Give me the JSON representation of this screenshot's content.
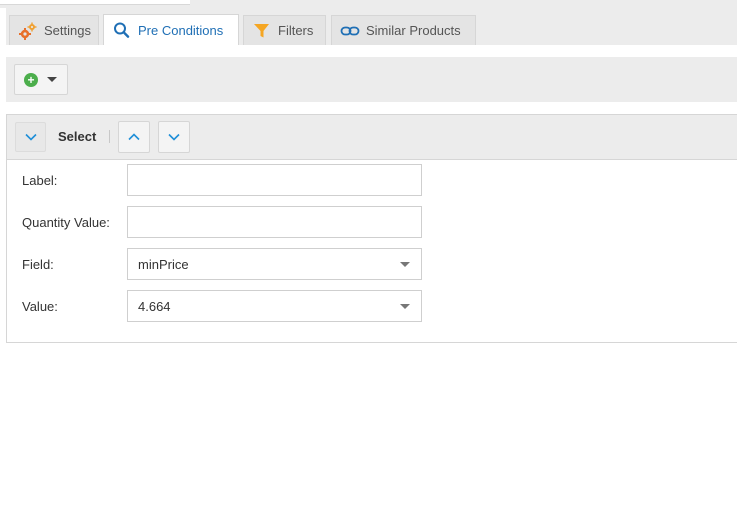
{
  "tabs": [
    {
      "label": "Settings",
      "icon": "gears-icon",
      "active": false
    },
    {
      "label": "Pre Conditions",
      "icon": "search-icon",
      "active": true
    },
    {
      "label": "Filters",
      "icon": "funnel-icon",
      "active": false
    },
    {
      "label": "Similar Products",
      "icon": "link-icon",
      "active": false
    }
  ],
  "toolbar": {
    "add_icon": "plus-circle-icon",
    "dropdown_icon": "caret-down-icon"
  },
  "panel": {
    "title": "Select",
    "fields": {
      "label": {
        "label": "Label:",
        "value": ""
      },
      "quantity": {
        "label": "Quantity Value:",
        "value": ""
      },
      "field": {
        "label": "Field:",
        "value": "minPrice"
      },
      "value": {
        "label": "Value:",
        "value": "4.664"
      }
    }
  },
  "colors": {
    "accent": "#1f6fb5",
    "add_green": "#4cae4c",
    "gear_orange": "#e8702a",
    "funnel_orange": "#f5a623"
  }
}
